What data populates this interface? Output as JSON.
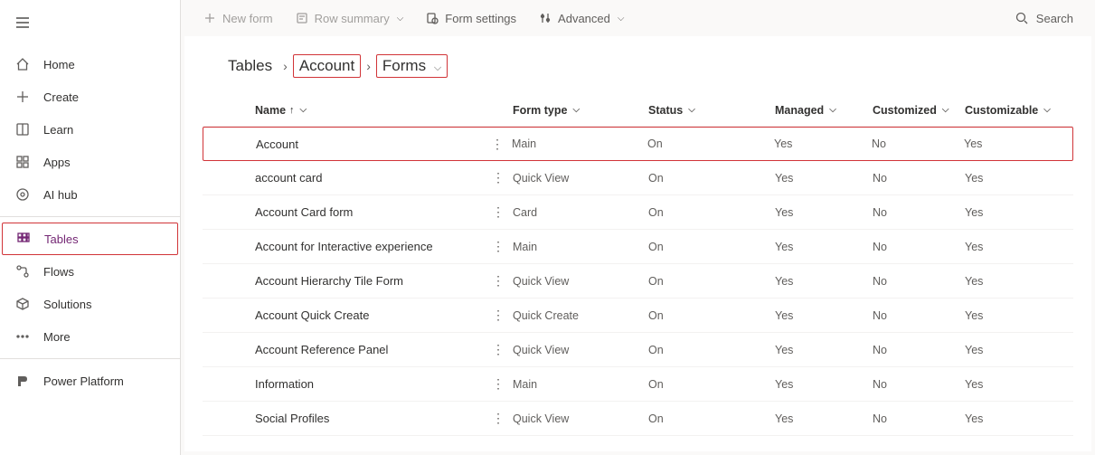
{
  "sidebar": {
    "items": [
      {
        "label": "Home"
      },
      {
        "label": "Create"
      },
      {
        "label": "Learn"
      },
      {
        "label": "Apps"
      },
      {
        "label": "AI hub"
      },
      {
        "label": "Tables"
      },
      {
        "label": "Flows"
      },
      {
        "label": "Solutions"
      },
      {
        "label": "More"
      },
      {
        "label": "Power Platform"
      }
    ]
  },
  "toolbar": {
    "new_form": "New form",
    "row_summary": "Row summary",
    "form_settings": "Form settings",
    "advanced": "Advanced",
    "search_placeholder": "Search"
  },
  "breadcrumb": {
    "root": "Tables",
    "entity": "Account",
    "leaf": "Forms"
  },
  "columns": {
    "name": "Name",
    "form_type": "Form type",
    "status": "Status",
    "managed": "Managed",
    "customized": "Customized",
    "customizable": "Customizable"
  },
  "rows": [
    {
      "name": "Account",
      "form_type": "Main",
      "status": "On",
      "managed": "Yes",
      "customized": "No",
      "customizable": "Yes",
      "highlight": true
    },
    {
      "name": "account card",
      "form_type": "Quick View",
      "status": "On",
      "managed": "Yes",
      "customized": "No",
      "customizable": "Yes"
    },
    {
      "name": "Account Card form",
      "form_type": "Card",
      "status": "On",
      "managed": "Yes",
      "customized": "No",
      "customizable": "Yes"
    },
    {
      "name": "Account for Interactive experience",
      "form_type": "Main",
      "status": "On",
      "managed": "Yes",
      "customized": "No",
      "customizable": "Yes"
    },
    {
      "name": "Account Hierarchy Tile Form",
      "form_type": "Quick View",
      "status": "On",
      "managed": "Yes",
      "customized": "No",
      "customizable": "Yes"
    },
    {
      "name": "Account Quick Create",
      "form_type": "Quick Create",
      "status": "On",
      "managed": "Yes",
      "customized": "No",
      "customizable": "Yes"
    },
    {
      "name": "Account Reference Panel",
      "form_type": "Quick View",
      "status": "On",
      "managed": "Yes",
      "customized": "No",
      "customizable": "Yes"
    },
    {
      "name": "Information",
      "form_type": "Main",
      "status": "On",
      "managed": "Yes",
      "customized": "No",
      "customizable": "Yes"
    },
    {
      "name": "Social Profiles",
      "form_type": "Quick View",
      "status": "On",
      "managed": "Yes",
      "customized": "No",
      "customizable": "Yes"
    }
  ]
}
